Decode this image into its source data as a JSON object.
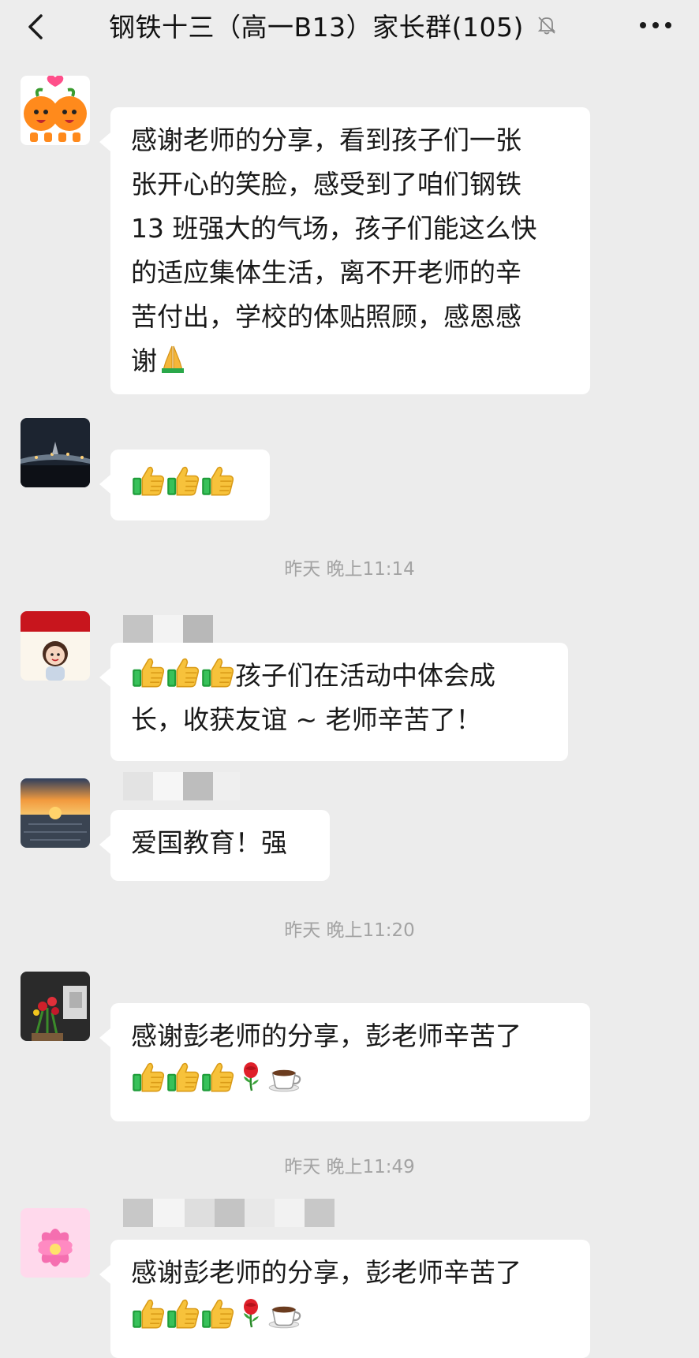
{
  "header": {
    "title": "钢铁十三（高一B13）家长群(105)",
    "back_icon": "chevron-left-icon",
    "mute_icon": "bell-off-icon",
    "more_icon": "more-horizontal-icon"
  },
  "messages": [
    {
      "text": "感谢老师的分享，看到孩子们一张张开心的笑脸，感受到了咱们钢铁13 班强大的气场，孩子们能这么快的适应集体生活，离不开老师的辛苦付出，学校的体贴照顾，感恩感谢",
      "emoji": "pray-hands"
    },
    {
      "text": "",
      "emoji": "thumbs-up x3"
    },
    {
      "text": "孩子们在活动中体会成长，收获友谊 ~ 老师辛苦了！",
      "emoji": "thumbs-up x3"
    },
    {
      "text": "爱国教育！强"
    },
    {
      "text": "感谢彭老师的分享，彭老师辛苦了",
      "emoji": "thumbs-up x3, rose, coffee"
    },
    {
      "text": "感谢彭老师的分享，彭老师辛苦了",
      "emoji": "thumbs-up x3, rose, coffee"
    }
  ],
  "timestamps": [
    "昨天 晚上11:14",
    "昨天 晚上11:20",
    "昨天 晚上11:49"
  ],
  "avatars": [
    "orange-couple-avatar",
    "night-bridge-avatar",
    "cartoon-girl-avatar",
    "sunset-sea-avatar",
    "flowers-avatar",
    "lotus-avatar"
  ],
  "lines": {
    "m1": [
      "感谢老师的分享，看到孩子们一张",
      "张开心的笑脸，感受到了咱们钢铁",
      "13 班强大的气场，孩子们能这么快",
      "的适应集体生活，离不开老师的辛",
      "苦付出，学校的体贴照顾，感恩感",
      "谢"
    ],
    "m3": [
      "孩子们在活动中体会成",
      "长，收获友谊 ~ 老师辛苦了！"
    ],
    "m4": [
      "爱国教育！强"
    ],
    "m5": [
      "感谢彭老师的分享，彭老师辛苦了"
    ],
    "m6": [
      "感谢彭老师的分享，彭老师辛苦了"
    ]
  },
  "colors": {
    "background": "#ececec",
    "bubble": "#ffffff",
    "timestamp": "#a3a3a3"
  }
}
